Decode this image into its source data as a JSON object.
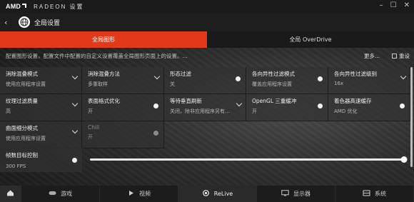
{
  "titlebar": {
    "brand": "AMD",
    "app_name": "RADEON 设置"
  },
  "header": {
    "title": "全局设置"
  },
  "tabs": [
    {
      "label": "全局图形",
      "active": true
    },
    {
      "label": "全局 OverDrive",
      "active": false
    }
  ],
  "description": "配置图形设置，配置文件中配置的自定义设置覆盖全局图形页面上的设置。...",
  "actions": {
    "more": "更多...",
    "reset": "重设"
  },
  "tiles": [
    [
      {
        "label": "消除混叠模式",
        "value": "使用应用程序设置",
        "control": "chevron"
      },
      {
        "label": "消除混叠方法",
        "value": "多重取样",
        "control": "chevron"
      },
      {
        "label": "形态过滤",
        "value": "关",
        "control": "toggle"
      },
      {
        "label": "各向异性过滤模式",
        "value": "覆盖应用程序设置",
        "control": "toggle"
      },
      {
        "label": "各向异性过滤级别",
        "value": "16x",
        "control": "chevron"
      }
    ],
    [
      {
        "label": "纹理过滤质量",
        "value": "高",
        "control": "chevron"
      },
      {
        "label": "表面格式优化",
        "value": "开",
        "control": "toggle"
      },
      {
        "label": "等待垂直刷新",
        "value": "关闭，除非应用程序另有...",
        "control": "chevron"
      },
      {
        "label": "OpenGL 三重缓冲",
        "value": "开",
        "control": "toggle"
      },
      {
        "label": "着色器高速缓存",
        "value": "AMD 优化",
        "control": "toggle"
      }
    ],
    [
      {
        "label": "曲面细分模式",
        "value": "使用应用程序设置",
        "control": "chevron"
      },
      {
        "label": "Chill",
        "value": "开",
        "control": "toggle",
        "disabled": true
      }
    ]
  ],
  "frame_target": {
    "label": "帧数目标控制",
    "value": "300 FPS",
    "slider_fraction": 1.0
  },
  "bottom_nav": [
    {
      "label": "",
      "icon": "home-icon"
    },
    {
      "label": "游戏",
      "icon": "gamepad-icon"
    },
    {
      "label": "视频",
      "icon": "play-icon"
    },
    {
      "label": "ReLive",
      "icon": "relive-icon"
    },
    {
      "label": "显示器",
      "icon": "monitor-icon"
    },
    {
      "label": "系统",
      "icon": "system-icon"
    }
  ],
  "colors": {
    "accent": "#e2391b",
    "background": "#262626"
  }
}
